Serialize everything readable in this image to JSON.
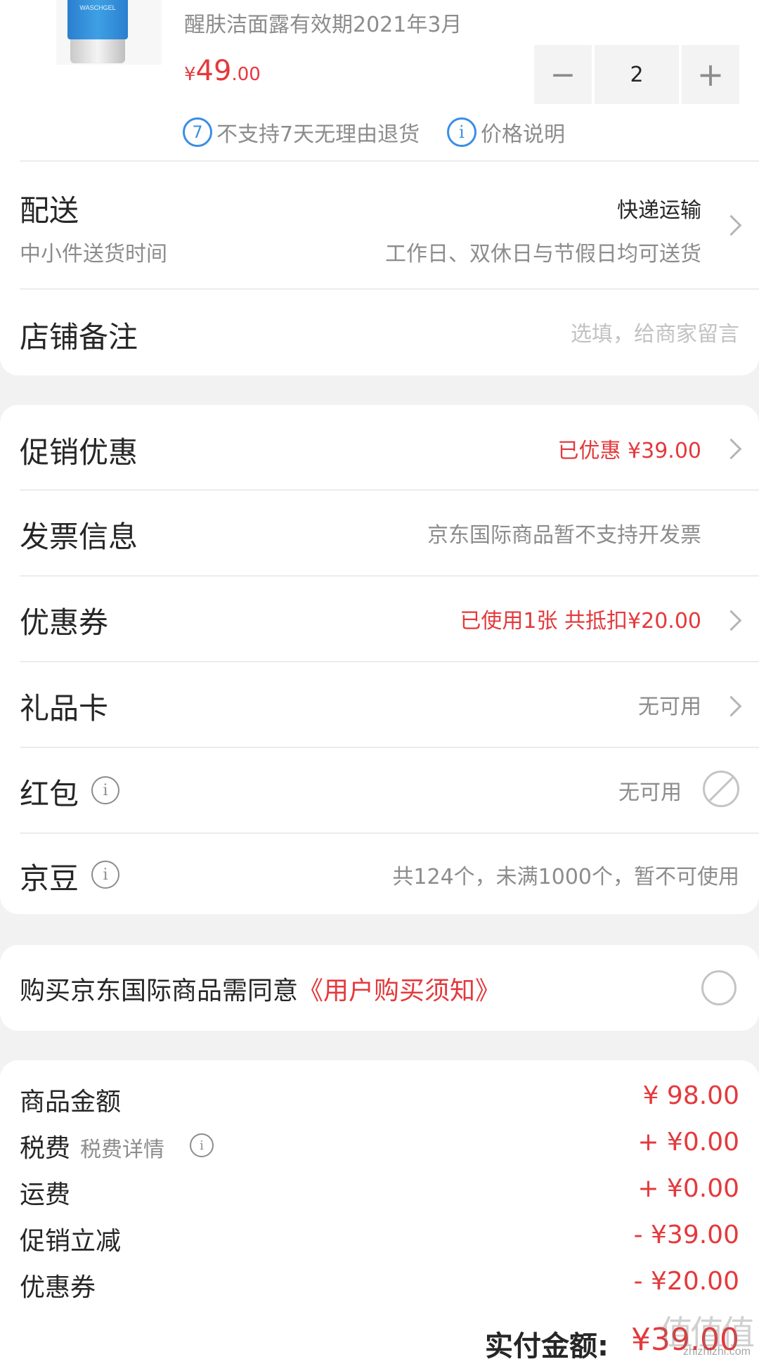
{
  "product": {
    "name": "醒肤洁面露有效期2021年3月",
    "image_label": "WASCHGEL",
    "price_symbol": "¥",
    "price_int": "49",
    "price_dec": ".00",
    "quantity": "2",
    "minus": "−",
    "plus": "+",
    "no_return_badge": "7",
    "no_return_text": "不支持7天无理由退货",
    "price_note_icon": "i",
    "price_note_text": "价格说明"
  },
  "delivery": {
    "label": "配送",
    "method": "快递运输",
    "time_label": "中小件送货时间",
    "time_value": "工作日、双休日与节假日均可送货"
  },
  "store_note": {
    "label": "店铺备注",
    "placeholder": "选填，给商家留言"
  },
  "options": {
    "promotion": {
      "label": "促销优惠",
      "value": "已优惠 ¥39.00"
    },
    "invoice": {
      "label": "发票信息",
      "value": "京东国际商品暂不支持开发票"
    },
    "coupon": {
      "label": "优惠券",
      "value": "已使用1张 共抵扣¥20.00"
    },
    "giftcard": {
      "label": "礼品卡",
      "value": "无可用"
    },
    "redpacket": {
      "label": "红包",
      "value": "无可用"
    },
    "jingdou": {
      "label": "京豆",
      "value": "共124个，未满1000个，暂不可使用"
    },
    "info_icon": "i"
  },
  "agreement": {
    "text": "购买京东国际商品需同意",
    "link": "《用户购买须知》"
  },
  "summary": {
    "goods_label": "商品金额",
    "goods_value": "¥ 98.00",
    "tax_label": "税费",
    "tax_detail": "税费详情",
    "tax_value": "+ ¥0.00",
    "shipping_label": "运费",
    "shipping_value": "+ ¥0.00",
    "promo_label": "促销立减",
    "promo_value": "- ¥39.00",
    "coupon_label": "优惠券",
    "coupon_value": "- ¥20.00",
    "total_label": "实付金额:",
    "total_value": "¥39.00"
  },
  "watermark": {
    "logo": "值值值",
    "site": "zhizhizhi.com"
  },
  "colors": {
    "accent_red": "#e4393c",
    "icon_blue": "#3a8ee6",
    "gray_text": "#8c8c8c",
    "background": "#f2f2f2"
  }
}
